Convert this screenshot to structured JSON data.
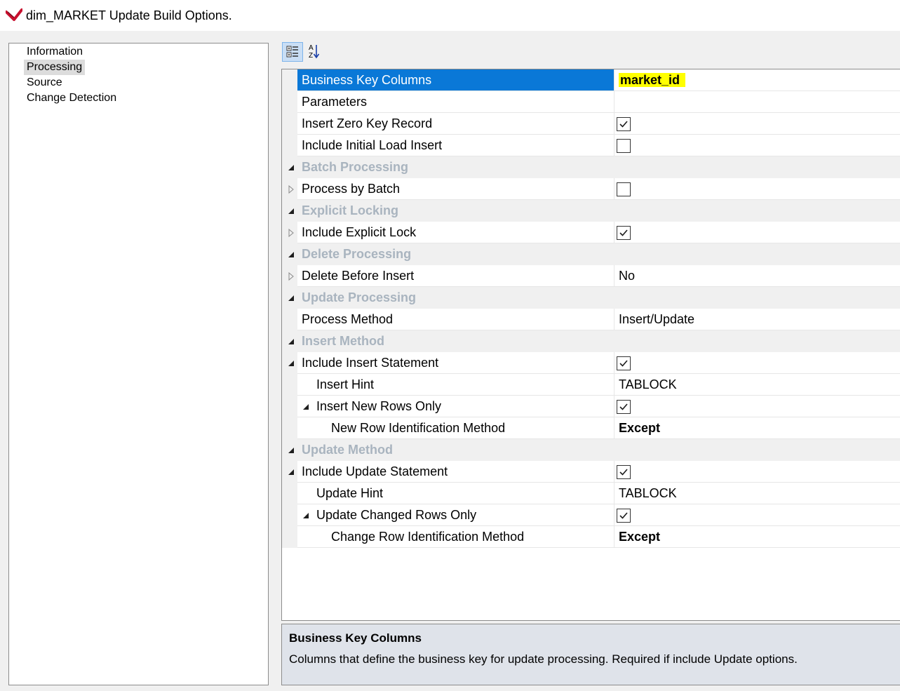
{
  "window": {
    "title": "dim_MARKET Update Build Options."
  },
  "nav": {
    "items": [
      {
        "label": "Information",
        "selected": false
      },
      {
        "label": "Processing",
        "selected": true
      },
      {
        "label": "Source",
        "selected": false
      },
      {
        "label": "Change Detection",
        "selected": false
      }
    ]
  },
  "toolbar": {
    "categorized_icon": "categorized-view-icon",
    "alphabetical_icon": "sort-alphabetical-icon",
    "alphabetical_label": "A Z"
  },
  "properties": {
    "rows": [
      {
        "name": "Business Key Columns",
        "value": "market_id",
        "kind": "text",
        "selected": true,
        "highlight": true
      },
      {
        "name": "Parameters",
        "value": "",
        "kind": "text"
      },
      {
        "name": "Insert Zero Key Record",
        "kind": "checkbox",
        "checked": true
      },
      {
        "name": "Include Initial Load Insert",
        "kind": "checkbox",
        "checked": false
      },
      {
        "name": "Batch Processing",
        "kind": "category",
        "expanded": true
      },
      {
        "name": "Process by Batch",
        "kind": "checkbox",
        "checked": false,
        "expander": "collapsed"
      },
      {
        "name": "Explicit Locking",
        "kind": "category",
        "expanded": true
      },
      {
        "name": "Include Explicit Lock",
        "kind": "checkbox",
        "checked": true,
        "expander": "collapsed"
      },
      {
        "name": "Delete Processing",
        "kind": "category",
        "expanded": true
      },
      {
        "name": "Delete Before Insert",
        "value": "No",
        "kind": "text",
        "expander": "collapsed"
      },
      {
        "name": "Update Processing",
        "kind": "category",
        "expanded": true
      },
      {
        "name": "Process Method",
        "value": "Insert/Update",
        "kind": "text"
      },
      {
        "name": "Insert Method",
        "kind": "category",
        "expanded": true
      },
      {
        "name": "Include Insert Statement",
        "kind": "checkbox",
        "checked": true,
        "expander": "expanded"
      },
      {
        "name": "Insert Hint",
        "value": "TABLOCK",
        "kind": "text",
        "indent": 1
      },
      {
        "name": "Insert New Rows Only",
        "kind": "checkbox",
        "checked": true,
        "indent": 1,
        "expander": "expanded"
      },
      {
        "name": "New Row Identification Method",
        "value": "Except",
        "kind": "text",
        "indent": 2,
        "bold": true
      },
      {
        "name": "Update Method",
        "kind": "category",
        "expanded": true
      },
      {
        "name": "Include Update Statement",
        "kind": "checkbox",
        "checked": true,
        "expander": "expanded"
      },
      {
        "name": "Update Hint",
        "value": "TABLOCK",
        "kind": "text",
        "indent": 1
      },
      {
        "name": "Update Changed Rows Only",
        "kind": "checkbox",
        "checked": true,
        "indent": 1,
        "expander": "expanded"
      },
      {
        "name": "Change Row Identification Method",
        "value": "Except",
        "kind": "text",
        "indent": 2,
        "bold": true
      }
    ]
  },
  "description": {
    "title": "Business Key Columns",
    "text": "Columns that define the business key for update processing. Required if include Update options."
  },
  "colors": {
    "selection": "#0a78d7",
    "highlight": "#ffff00",
    "category_text": "#a9b4bf",
    "description_bg": "#dfe3ea"
  }
}
